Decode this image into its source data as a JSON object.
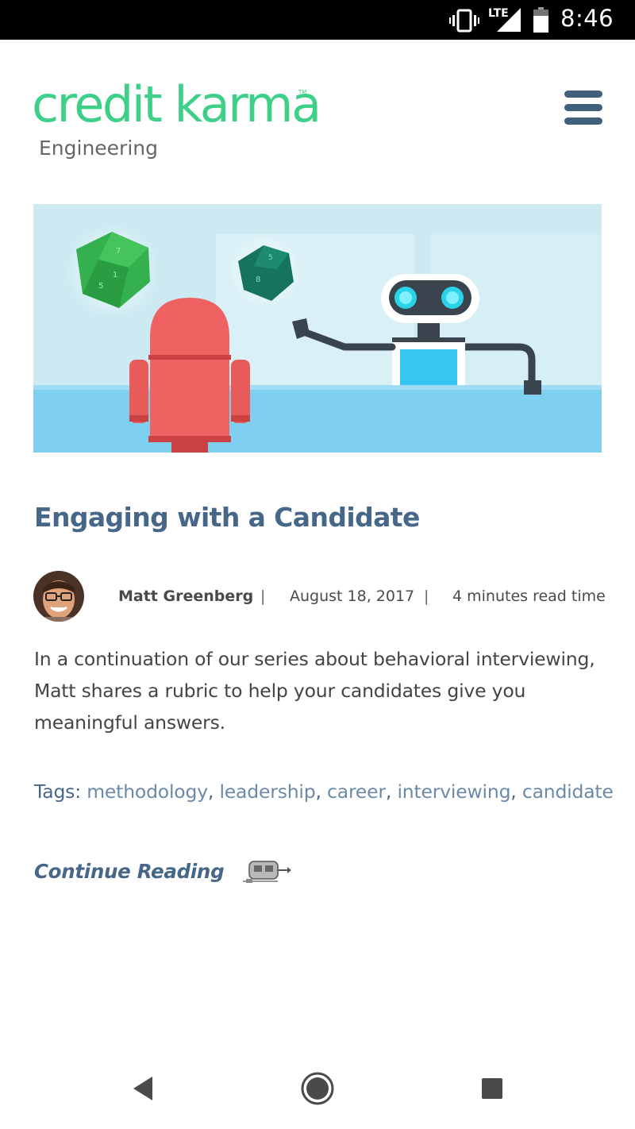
{
  "status_bar": {
    "network": "LTE",
    "time": "8:46",
    "icons": [
      "vibrate-icon",
      "signal-icon",
      "battery-icon"
    ]
  },
  "header": {
    "logo_text": "credit karma",
    "logo_tm": "TM",
    "subtitle": "Engineering",
    "menu_icon": "hamburger-menu-icon",
    "brand_color": "#3ed089"
  },
  "hero": {
    "illustration": "robots-with-dice"
  },
  "article": {
    "title": "Engaging with a Candidate",
    "author": "Matt Greenberg",
    "separator": "|",
    "date": "August 18, 2017",
    "read_time": "4 minutes read time",
    "excerpt": "In a continuation of our series about behavioral interviewing, Matt shares a rubric to help your candidates give you meaningful answers.",
    "tags_label": "Tags:",
    "tags": [
      "methodology",
      "leadership",
      "career",
      "interviewing",
      "candidate"
    ],
    "continue_label": "Continue Reading",
    "accent_color": "#466788"
  },
  "nav_bar": {
    "icons": [
      "back-icon",
      "home-icon",
      "recent-apps-icon"
    ]
  }
}
